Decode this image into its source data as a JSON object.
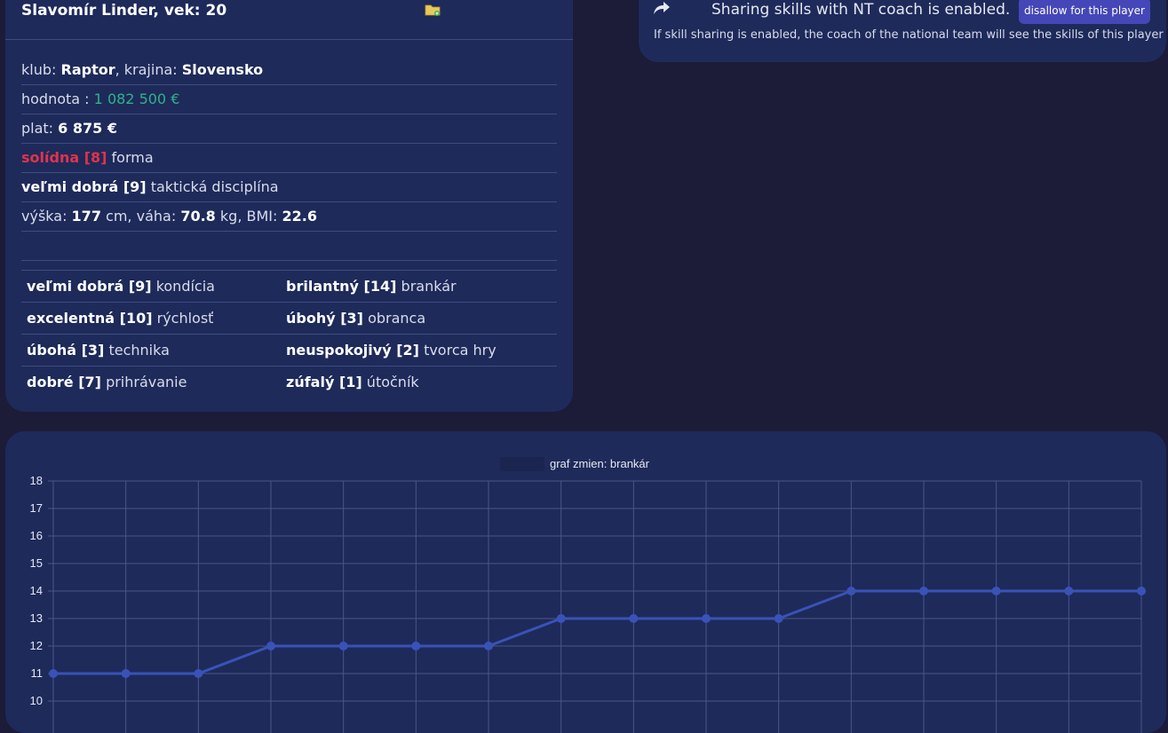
{
  "player": {
    "header": "Slavomír Linder, vek: 20",
    "club_label": "klub:",
    "club": "Raptor",
    "country_label": ", krajina:",
    "country": "Slovensko",
    "value_label": "hodnota :",
    "value": "1 082 500 €",
    "salary_label": "plat:",
    "salary": "6 875 €",
    "form_level": "solídna [8]",
    "form_label": "forma",
    "discipline_level": "veľmi dobrá [9]",
    "discipline_label": "taktická disciplína",
    "height_label": "výška:",
    "height": "177",
    "height_unit": "cm, váha:",
    "weight": "70.8",
    "weight_unit": "kg, BMI:",
    "bmi": "22.6"
  },
  "skills": [
    [
      {
        "level": "veľmi dobrá [9]",
        "name": "kondícia",
        "tone": "normal"
      },
      {
        "level": "brilantný [14]",
        "name": "brankár",
        "tone": "normal"
      }
    ],
    [
      {
        "level": "excelentná [10]",
        "name": "rýchlosť",
        "tone": "normal"
      },
      {
        "level": "úbohý [3]",
        "name": "obranca",
        "tone": "normal"
      }
    ],
    [
      {
        "level": "úbohá [3]",
        "name": "technika",
        "tone": "normal"
      },
      {
        "level": "neuspokojivý [2]",
        "name": "tvorca hry",
        "tone": "normal"
      }
    ],
    [
      {
        "level": "dobré [7]",
        "name": "prihrávanie",
        "tone": "green"
      },
      {
        "level": "zúfalý [1]",
        "name": "útočník",
        "tone": "normal"
      }
    ]
  ],
  "nt_sharing": {
    "title": "Sharing skills with NT coach is enabled.",
    "button": "disallow for this player",
    "note": "If skill sharing is enabled, the coach of the national team will see the skills of this player"
  },
  "icons": {
    "folder": "folder-add-icon",
    "share": "share-arrow-icon"
  },
  "colors": {
    "accent_green": "#2fb38a",
    "accent_red": "#e0334d",
    "button": "#4547b8",
    "line": "#3a52b8"
  },
  "chart_data": {
    "type": "line",
    "title": "graf zmien: brankár",
    "series": [
      {
        "name": "graf zmien: brankár",
        "values": [
          11,
          11,
          11,
          12,
          12,
          12,
          12,
          13,
          13,
          13,
          13,
          14,
          14,
          14,
          14,
          14
        ]
      }
    ],
    "y_ticks": [
      "18",
      "17",
      "16",
      "15",
      "14",
      "13",
      "12",
      "11",
      "10"
    ],
    "ylim": [
      10,
      18
    ],
    "grid": true,
    "legend": "top"
  }
}
